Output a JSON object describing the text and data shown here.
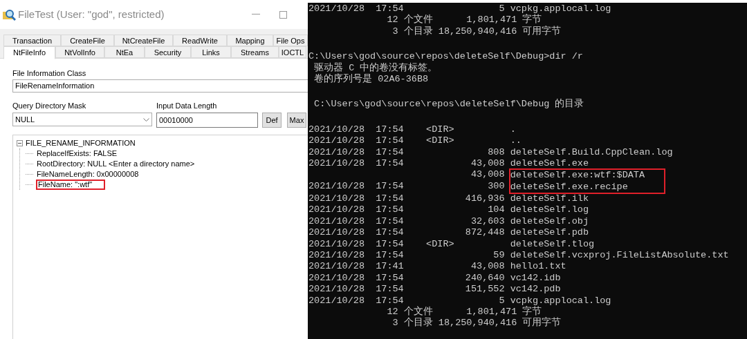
{
  "filetest_window": {
    "title": "FileTest (User: \"god\", restricted)",
    "tab_rows": [
      [
        {
          "label": "Transaction",
          "selected": false
        },
        {
          "label": "CreateFile",
          "selected": false
        },
        {
          "label": "NtCreateFile",
          "selected": false
        },
        {
          "label": "ReadWrite",
          "selected": false
        },
        {
          "label": "Mapping",
          "selected": false
        },
        {
          "label": "File Ops",
          "selected": false
        }
      ],
      [
        {
          "label": "NtFileInfo",
          "selected": true
        },
        {
          "label": "NtVolInfo",
          "selected": false
        },
        {
          "label": "NtEa",
          "selected": false
        },
        {
          "label": "Security",
          "selected": false
        },
        {
          "label": "Links",
          "selected": false
        },
        {
          "label": "Streams",
          "selected": false
        },
        {
          "label": "IOCTL",
          "selected": false
        }
      ]
    ],
    "file_information_class": {
      "label": "File Information Class",
      "value": "FileRenameInformation"
    },
    "query_directory_mask": {
      "label": "Query Directory Mask",
      "value": "NULL"
    },
    "input_data_length": {
      "label": "Input Data Length",
      "value": "00010000"
    },
    "buttons": [
      "Def",
      "Max"
    ],
    "tree": [
      {
        "label": "FILE_RENAME_INFORMATION",
        "expanded": true,
        "boxed": false,
        "children": [
          {
            "label": "ReplaceIfExists: FALSE",
            "boxed": false
          },
          {
            "label": "RootDirectory: NULL <Enter a directory name>",
            "boxed": false
          },
          {
            "label": "FileNameLength: 0x00000008",
            "boxed": false
          },
          {
            "label": "FileName: \":wtf\"",
            "boxed": true
          }
        ]
      }
    ]
  },
  "console": {
    "lines": [
      {
        "kind": "entry",
        "stamp": "2021/10/28  17:54",
        "size": "5",
        "name": "vcpkg.applocal.log",
        "boxed": false
      },
      {
        "kind": "text",
        "text": "              12 个文件      1,801,471 字节"
      },
      {
        "kind": "text",
        "text": "               3 个目录 18,250,940,416 可用字节"
      },
      {
        "kind": "blank"
      },
      {
        "kind": "text",
        "text": "C:\\Users\\god\\source\\repos\\deleteSelf\\Debug>dir /r"
      },
      {
        "kind": "text",
        "text": " 驱动器 C 中的卷没有标签。"
      },
      {
        "kind": "text",
        "text": " 卷的序列号是 02A6-36B8"
      },
      {
        "kind": "blank"
      },
      {
        "kind": "text",
        "text": " C:\\Users\\god\\source\\repos\\deleteSelf\\Debug 的目录"
      },
      {
        "kind": "blank"
      },
      {
        "kind": "entry",
        "stamp": "2021/10/28  17:54",
        "size": "<DIR>",
        "name": ".",
        "boxed": false
      },
      {
        "kind": "entry",
        "stamp": "2021/10/28  17:54",
        "size": "<DIR>",
        "name": "..",
        "boxed": false
      },
      {
        "kind": "entry",
        "stamp": "2021/10/28  17:54",
        "size": "808",
        "name": "deleteSelf.Build.CppClean.log",
        "boxed": false
      },
      {
        "kind": "entry",
        "stamp": "2021/10/28  17:54",
        "size": "43,008",
        "name": "deleteSelf.exe",
        "boxed": false
      },
      {
        "kind": "entry",
        "size": "43,008",
        "name": "deleteSelf.exe:wtf:$DATA",
        "boxed": true
      },
      {
        "kind": "entry",
        "stamp": "2021/10/28  17:54",
        "size": "300",
        "name": "deleteSelf.exe.recipe",
        "boxed": true
      },
      {
        "kind": "entry",
        "stamp": "2021/10/28  17:54",
        "size": "416,936",
        "name": "deleteSelf.ilk",
        "boxed": false
      },
      {
        "kind": "entry",
        "stamp": "2021/10/28  17:54",
        "size": "104",
        "name": "deleteSelf.log",
        "boxed": false
      },
      {
        "kind": "entry",
        "stamp": "2021/10/28  17:54",
        "size": "32,603",
        "name": "deleteSelf.obj",
        "boxed": false
      },
      {
        "kind": "entry",
        "stamp": "2021/10/28  17:54",
        "size": "872,448",
        "name": "deleteSelf.pdb",
        "boxed": false
      },
      {
        "kind": "entry",
        "stamp": "2021/10/28  17:54",
        "size": "<DIR>",
        "name": "deleteSelf.tlog",
        "boxed": false
      },
      {
        "kind": "entry",
        "stamp": "2021/10/28  17:54",
        "size": "59",
        "name": "deleteSelf.vcxproj.FileListAbsolute.txt",
        "boxed": false
      },
      {
        "kind": "entry",
        "stamp": "2021/10/28  17:41",
        "size": "43,008",
        "name": "hello1.txt",
        "boxed": false
      },
      {
        "kind": "entry",
        "stamp": "2021/10/28  17:54",
        "size": "240,640",
        "name": "vc142.idb",
        "boxed": false
      },
      {
        "kind": "entry",
        "stamp": "2021/10/28  17:54",
        "size": "151,552",
        "name": "vc142.pdb",
        "boxed": false
      },
      {
        "kind": "entry",
        "stamp": "2021/10/28  17:54",
        "size": "5",
        "name": "vcpkg.applocal.log",
        "boxed": false
      },
      {
        "kind": "text",
        "text": "              12 个文件      1,801,471 字节"
      },
      {
        "kind": "text",
        "text": "               3 个目录 18,250,940,416 可用字节"
      }
    ]
  }
}
